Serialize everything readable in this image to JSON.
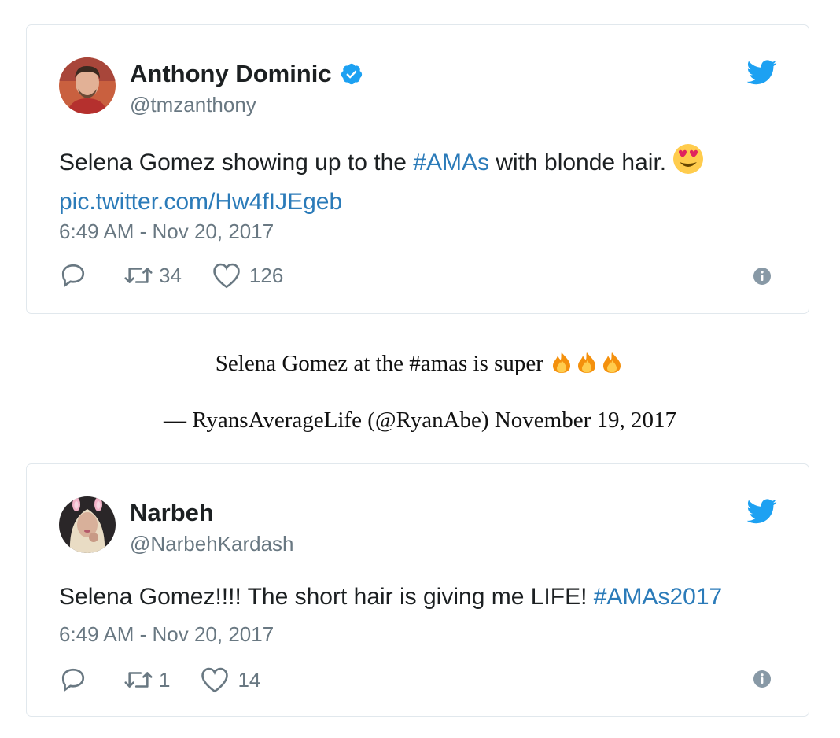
{
  "tweets": [
    {
      "user_name": "Anthony Dominic",
      "verified": true,
      "handle": "@tmzanthony",
      "text_before": "Selena Gomez showing up to the ",
      "hashtag": "#AMAs",
      "text_after": " with blonde hair.",
      "emoji": "smiling-face-with-heart-eyes-emoji",
      "link": "pic.twitter.com/Hw4fIJEgeb",
      "timestamp": "6:49 AM - Nov 20, 2017",
      "retweets": "34",
      "likes": "126"
    },
    {
      "user_name": "Narbeh",
      "verified": false,
      "handle": "@NarbehKardash",
      "text_before": "Selena Gomez!!!! The short hair is giving me LIFE! ",
      "hashtag": "#AMAs2017",
      "timestamp": "6:49 AM - Nov 20, 2017",
      "retweets": "1",
      "likes": "14"
    }
  ],
  "embed_quote": {
    "text": "Selena Gomez at the #amas is super",
    "emoji": "fire-emoji",
    "attribution": "— RyansAverageLife (@RyanAbe) November 19, 2017"
  },
  "colors": {
    "link": "#2b7bb9",
    "muted": "#697882",
    "border": "#e1e8ed",
    "twitter_blue": "#1da1f2"
  }
}
